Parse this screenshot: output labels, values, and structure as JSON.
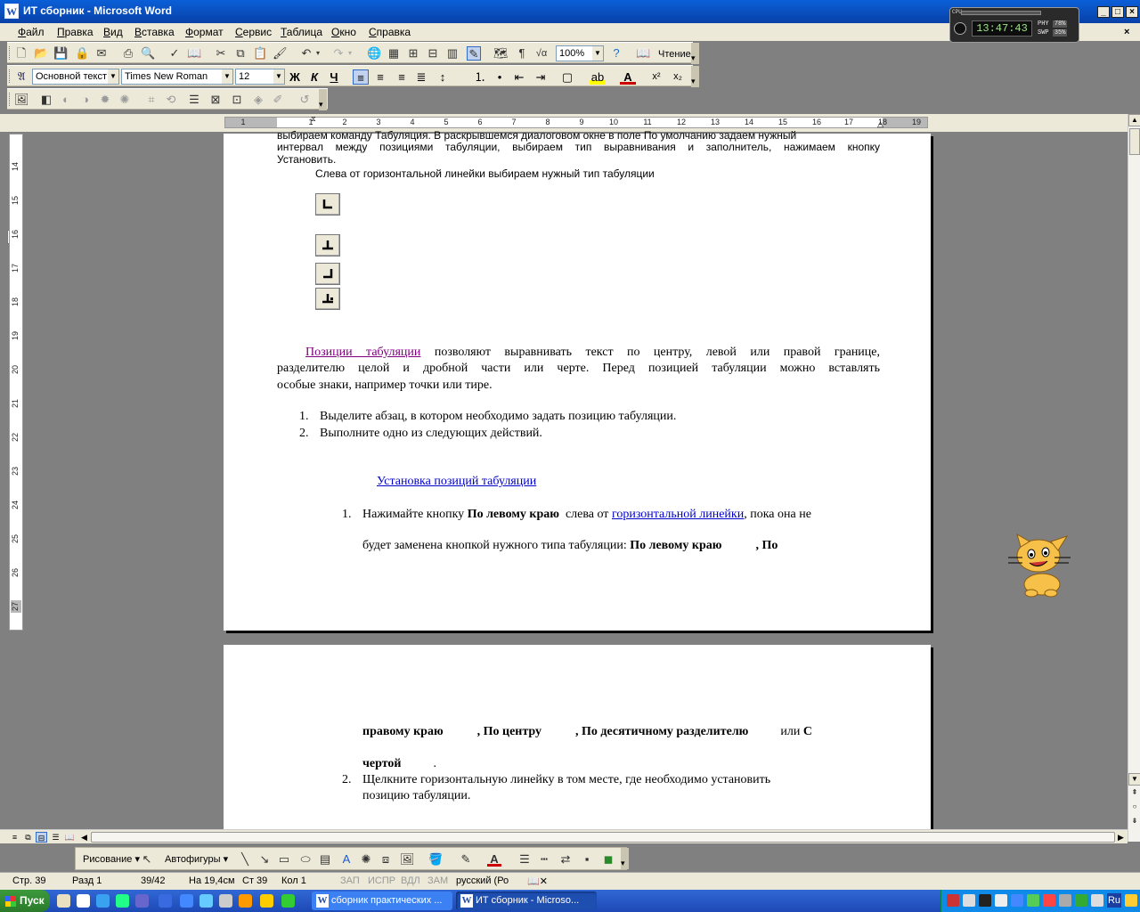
{
  "window": {
    "title": "ИТ сборник - Microsoft Word",
    "app_icon": "word-icon"
  },
  "clock_widget": {
    "time": "13:47:43",
    "indicator_1_label": "PHY",
    "indicator_1_value": "78%",
    "indicator_2_label": "SWP",
    "indicator_2_value": "35%",
    "bar_label": "CPU"
  },
  "menubar": {
    "items": [
      "Файл",
      "Правка",
      "Вид",
      "Вставка",
      "Формат",
      "Сервис",
      "Таблица",
      "Окно",
      "Справка"
    ]
  },
  "standard_toolbar": {
    "zoom": "100%",
    "reading_label": "Чтение"
  },
  "formatting_toolbar": {
    "style": "Основной текст",
    "font": "Times New Roman",
    "size": "12",
    "bold_label": "Ж",
    "italic_label": "К",
    "underline_label": "Ч"
  },
  "ruler": {
    "numbers": [
      "1",
      "1",
      "2",
      "3",
      "4",
      "5",
      "6",
      "7",
      "8",
      "9",
      "10",
      "11",
      "12",
      "13",
      "14",
      "15",
      "16",
      "17",
      "18",
      "19"
    ],
    "tab_selector": "L"
  },
  "vertical_ruler": {
    "numbers": [
      "14",
      "15",
      "16",
      "17",
      "18",
      "19",
      "20",
      "21",
      "22",
      "23",
      "24",
      "25",
      "26",
      "27"
    ]
  },
  "document": {
    "page1": {
      "cut_line": "выбираем команду Табуляция. В раскрывшемся диалоговом окне в поле По умолчанию задаем нужный",
      "para1": "интервал между позициями табуляции, выбираем тип выравнивания и заполнитель, нажимаем кнопку",
      "para1_end": "Установить.",
      "tab_type_intro": "Слева от горизонтальной линейки выбираем нужный тип табуляции",
      "tab_types": [
        "left-tab-icon",
        "center-tab-icon",
        "right-tab-icon",
        "decimal-tab-icon"
      ],
      "positions_link": "Позиции табуляции",
      "positions_line1": "позволяют выравнивать текст по центру, левой или правой границе,",
      "positions_line2": "разделителю целой и дробной части или черте. Перед позицией табуляции можно вставлять",
      "positions_line3": "особые знаки, например точки или тире.",
      "list1": [
        {
          "num": "1.",
          "text": "Выделите абзац, в котором необходимо задать позицию табуляции."
        },
        {
          "num": "2.",
          "text": "Выполните одно из следующих действий."
        }
      ],
      "install_link": "Установка позиций табуляции",
      "step1_num": "1.",
      "step1_a": "Нажимайте кнопку",
      "step1_bold": "По левому краю",
      "step1_b": "слева от",
      "step1_link": "горизонтальной линейки",
      "step1_c": ", пока она не",
      "step1_line2": "будет заменена кнопкой нужного типа табуляции:",
      "step1_bold2": "По левому краю",
      "step1_bold3": ", По"
    },
    "page2": {
      "b1": "правому краю",
      "b2": ", По центру",
      "b3": ", По десятичному разделителю",
      "b4a": "или",
      "b4b": "С",
      "b5": "чертой",
      "b5_end": ".",
      "step2_num": "2.",
      "step2_line1": "Щелкните горизонтальную линейку в том месте, где необходимо установить",
      "step2_line2": "позицию табуляции."
    }
  },
  "drawing_toolbar": {
    "drawing_label": "Рисование",
    "autoshapes_label": "Автофигуры"
  },
  "statusbar": {
    "page": "Стр. 39",
    "section": "Разд 1",
    "pages": "39/42",
    "at": "На 19,4см",
    "line": "Ст 39",
    "col": "Кол 1",
    "rec": "ЗАП",
    "trk": "ИСПР",
    "ext": "ВДЛ",
    "ovr": "ЗАМ",
    "lang": "русский (Ро"
  },
  "taskbar": {
    "start_label": "Пуск",
    "tasks": [
      "сборник практических ...",
      "ИТ сборник - Microso..."
    ],
    "tray_lang": "Ru"
  },
  "colors": {
    "title_bar": "#0a5fd8",
    "taskbar": "#3168d5",
    "link": "#0000cc",
    "visited_link": "#800080"
  }
}
